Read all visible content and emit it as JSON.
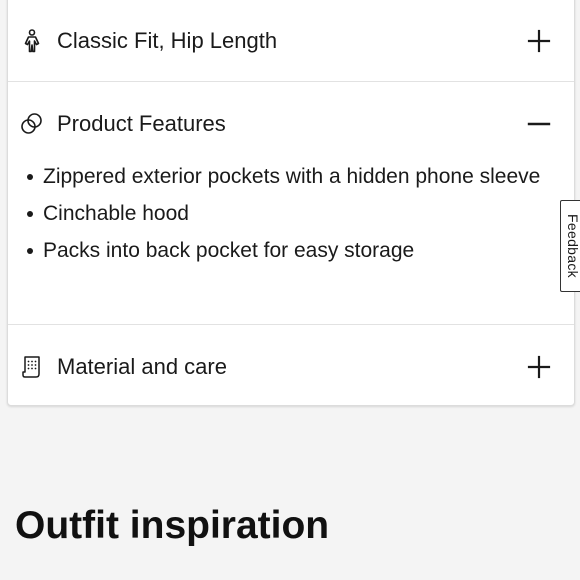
{
  "accordion": {
    "sections": [
      {
        "title": "Classic Fit, Hip Length",
        "icon": "person-fit-icon",
        "expanded": false,
        "toggle_icon": "plus-icon"
      },
      {
        "title": "Product Features",
        "icon": "features-icon",
        "expanded": true,
        "toggle_icon": "minus-icon",
        "items": [
          "Zippered exterior pockets with a hidden phone sleeve",
          "Cinchable hood",
          "Packs into back pocket for easy storage"
        ]
      },
      {
        "title": "Material and care",
        "icon": "care-label-icon",
        "expanded": false,
        "toggle_icon": "plus-icon"
      }
    ]
  },
  "outfit_section": {
    "title": "Outfit inspiration"
  },
  "feedback_tab": {
    "label": "Feedback"
  }
}
